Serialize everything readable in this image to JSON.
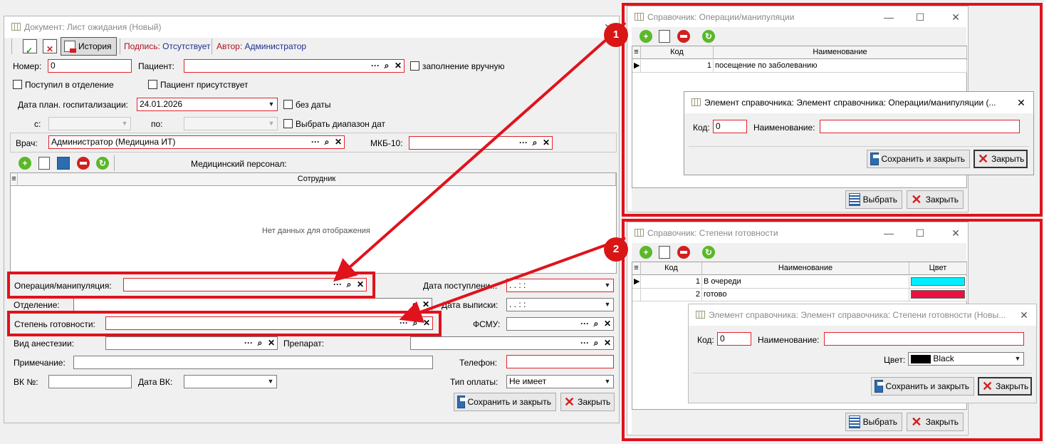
{
  "main": {
    "title": "Документ: Лист ожидания (Новый)",
    "history_label": "История",
    "sign_label": "Подпись:",
    "sign_value": "Отсутствует",
    "author_label": "Автор:",
    "author_value": "Администратор",
    "nomer_label": "Номер:",
    "nomer_value": "0",
    "patient_label": "Пациент:",
    "manual_label": "заполнение вручную",
    "admitted_label": "Поступил в отделение",
    "present_label": "Пациент присутствует",
    "date_label": "Дата план. госпитализации:",
    "date_value": "24.01.2026",
    "nodate_label": "без даты",
    "from_label": "с:",
    "to_label": "по:",
    "range_label": "Выбрать диапазон дат",
    "doctor_label": "Врач:",
    "doctor_value": "Администратор (Медицина ИТ)",
    "mkb_label": "МКБ-10:",
    "staff_label": "Медицинский персонал:",
    "staff_col": "Сотрудник",
    "empty_text": "Нет данных для отображения",
    "op_label": "Операция/манипуляция:",
    "arrival_label": "Дата поступлени...",
    "arrival_value": " .  .       :  :",
    "dept_label": "Отделение:",
    "discharge_label": "Дата выписки:",
    "discharge_value": " .  .       :  :",
    "ready_label": "Степень готовности:",
    "fsmu_label": "ФСМУ:",
    "anest_label": "Вид анестезии:",
    "drug_label": "Препарат:",
    "note_label": "Примечание:",
    "phone_label": "Телефон:",
    "vk_label": "ВК №:",
    "vkdate_label": "Дата ВК:",
    "paytype_label": "Тип оплаты:",
    "paytype_value": "Не имеет",
    "save_close": "Сохранить и закрыть",
    "close": "Закрыть"
  },
  "ref1": {
    "title": "Справочник: Операции/манипуляции",
    "col_code": "Код",
    "col_name": "Наименование",
    "rows": [
      {
        "code": "1",
        "name": "посещение по заболеванию"
      }
    ],
    "select": "Выбрать",
    "close": "Закрыть",
    "element": {
      "title": "Элемент справочника: Элемент справочника: Операции/манипуляции (...",
      "code_label": "Код:",
      "code_value": "0",
      "name_label": "Наименование:",
      "save_close": "Сохранить и закрыть",
      "close": "Закрыть"
    }
  },
  "ref2": {
    "title": "Справочник: Степени готовности",
    "col_code": "Код",
    "col_name": "Наименование",
    "col_color": "Цвет",
    "rows": [
      {
        "code": "1",
        "name": "В очереди",
        "color": "#00eeff"
      },
      {
        "code": "2",
        "name": "готово",
        "color": "#e8113f"
      }
    ],
    "select": "Выбрать",
    "close": "Закрыть",
    "element": {
      "title": "Элемент справочника: Элемент справочника: Степени готовности (Новы...",
      "code_label": "Код:",
      "code_value": "0",
      "name_label": "Наименование:",
      "color_label": "Цвет:",
      "color_value": "Black",
      "save_close": "Сохранить и закрыть",
      "close": "Закрыть"
    }
  },
  "annotations": {
    "badge1": "1",
    "badge2": "2",
    "highlight_color": "#e0121c"
  }
}
